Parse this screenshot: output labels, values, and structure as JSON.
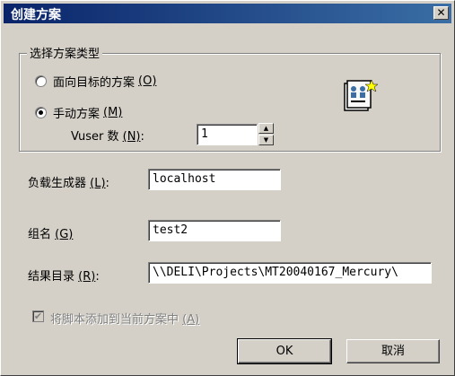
{
  "window": {
    "title": "创建方案",
    "close_glyph": "✕"
  },
  "scenario_type": {
    "group_label": "选择方案类型",
    "goal_oriented": {
      "label": "面向目标的方案",
      "mnemonic": "(O)",
      "checked": false
    },
    "manual": {
      "label": "手动方案",
      "mnemonic": "(M)",
      "checked": true
    },
    "vuser_label": "Vuser 数",
    "vuser_mnemonic": "(N)",
    "vuser_suffix": ":",
    "vuser_count": "1"
  },
  "load_generator": {
    "label": "负载生成器",
    "mnemonic": "(L)",
    "suffix": ":",
    "value": "localhost"
  },
  "group_name": {
    "label": "组名",
    "mnemonic": "(G)",
    "value": "test2"
  },
  "results_dir": {
    "label": "结果目录",
    "mnemonic": "(R)",
    "suffix": ":",
    "value": "\\\\DELI\\Projects\\MT20040167_Mercury\\"
  },
  "add_script": {
    "label": "将脚本添加到当前方案中",
    "mnemonic": "(A)",
    "checked": true,
    "enabled": false
  },
  "buttons": {
    "ok": "OK",
    "cancel": "取消"
  },
  "icons": {
    "scenario": "scenario-document-icon"
  },
  "colors": {
    "title_bar": "#0a246a",
    "face": "#d4d0c8"
  }
}
